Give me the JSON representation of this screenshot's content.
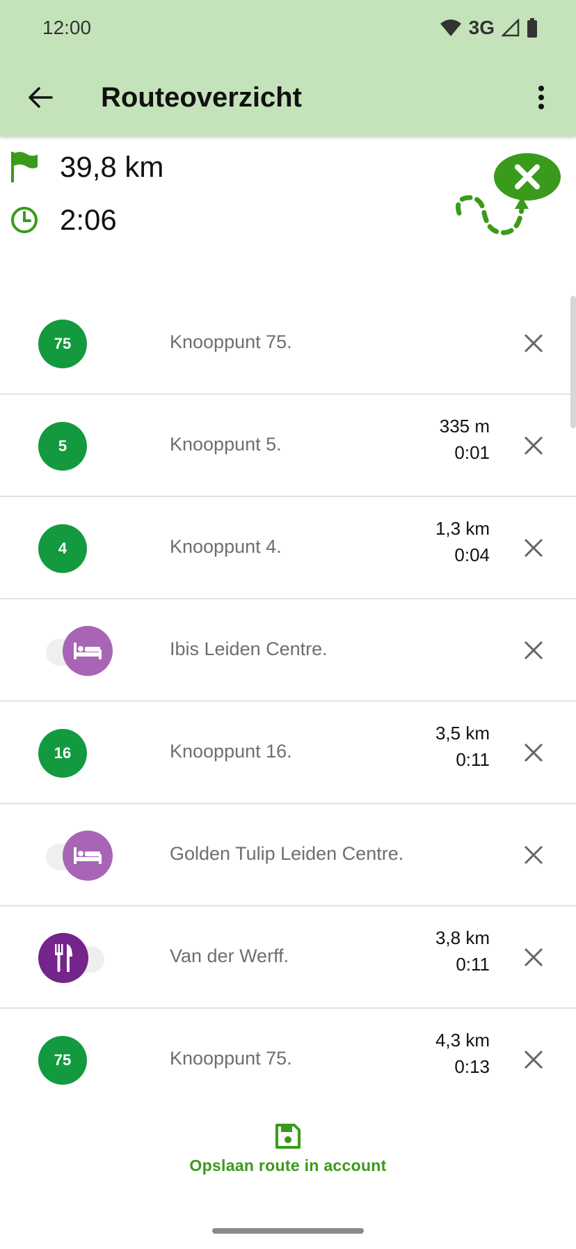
{
  "status_bar": {
    "time": "12:00",
    "network": "3G"
  },
  "toolbar": {
    "title": "Routeoverzicht"
  },
  "summary": {
    "distance": "39,8 km",
    "duration": "2:06"
  },
  "colors": {
    "appbar": "#c5e3ba",
    "accent_green": "#3a9a1b",
    "badge_green": "#139a3e",
    "poi_light_purple": "#a865b5",
    "poi_dark_purple": "#74248a"
  },
  "items": [
    {
      "kind": "badge",
      "badge": "75",
      "label": "Knooppunt 75.",
      "dist": "",
      "time": ""
    },
    {
      "kind": "badge",
      "badge": "5",
      "label": "Knooppunt 5.",
      "dist": "335 m",
      "time": "0:01"
    },
    {
      "kind": "badge",
      "badge": "4",
      "label": "Knooppunt 4.",
      "dist": "1,3 km",
      "time": "0:04"
    },
    {
      "kind": "poi-bed",
      "icon": "bed-icon",
      "label": "Ibis Leiden Centre.",
      "dist": "",
      "time": ""
    },
    {
      "kind": "badge",
      "badge": "16",
      "label": "Knooppunt 16.",
      "dist": "3,5 km",
      "time": "0:11"
    },
    {
      "kind": "poi-bed",
      "icon": "bed-icon",
      "label": "Golden Tulip Leiden Centre.",
      "dist": "",
      "time": ""
    },
    {
      "kind": "poi-food",
      "icon": "fork-knife-icon",
      "label": "Van der Werff.",
      "dist": "3,8 km",
      "time": "0:11"
    },
    {
      "kind": "badge",
      "badge": "75",
      "label": "Knooppunt 75.",
      "dist": "4,3 km",
      "time": "0:13"
    }
  ],
  "save": {
    "label": "Opslaan route in account",
    "icon": "save-icon"
  }
}
